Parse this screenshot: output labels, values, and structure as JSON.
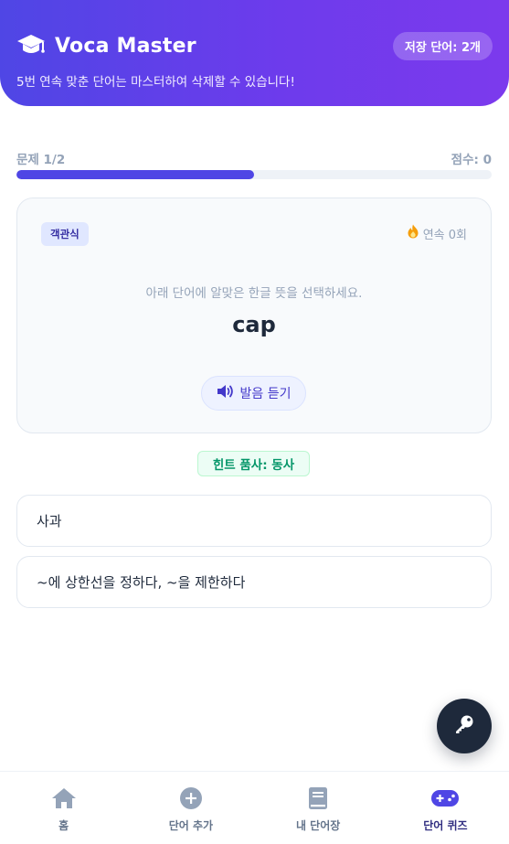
{
  "header": {
    "title": "Voca Master",
    "saved_badge": "저장 단어: 2개",
    "tagline": "5번 연속 맞춘 단어는 마스터하여 삭제할 수 있습니다!",
    "icon": "graduation-cap-icon"
  },
  "progress": {
    "question_label": "문제 1/2",
    "score_label": "점수: 0",
    "fraction": 0.5
  },
  "question": {
    "type_badge": "객관식",
    "streak": "연속 0회",
    "instruction": "아래 단어에 알맞은 한글 뜻을 선택하세요.",
    "word": "cap",
    "listen_label": "발음 듣기"
  },
  "hint": "힌트 품사: 동사",
  "options": [
    {
      "label": "사과"
    },
    {
      "label": "~에 상한선을 정하다, ~을 제한하다"
    }
  ],
  "nav": [
    {
      "label": "홈",
      "icon": "home-icon",
      "active": false
    },
    {
      "label": "단어 추가",
      "icon": "plus-circle-icon",
      "active": false
    },
    {
      "label": "내 단어장",
      "icon": "book-icon",
      "active": false
    },
    {
      "label": "단어 퀴즈",
      "icon": "gamepad-icon",
      "active": true
    }
  ],
  "colors": {
    "accent": "#4f46e5",
    "header_gradient_end": "#7c3aed",
    "hint_green": "#059669",
    "fab_dark": "#1e293b",
    "streak_flame": "#f59e0b"
  }
}
